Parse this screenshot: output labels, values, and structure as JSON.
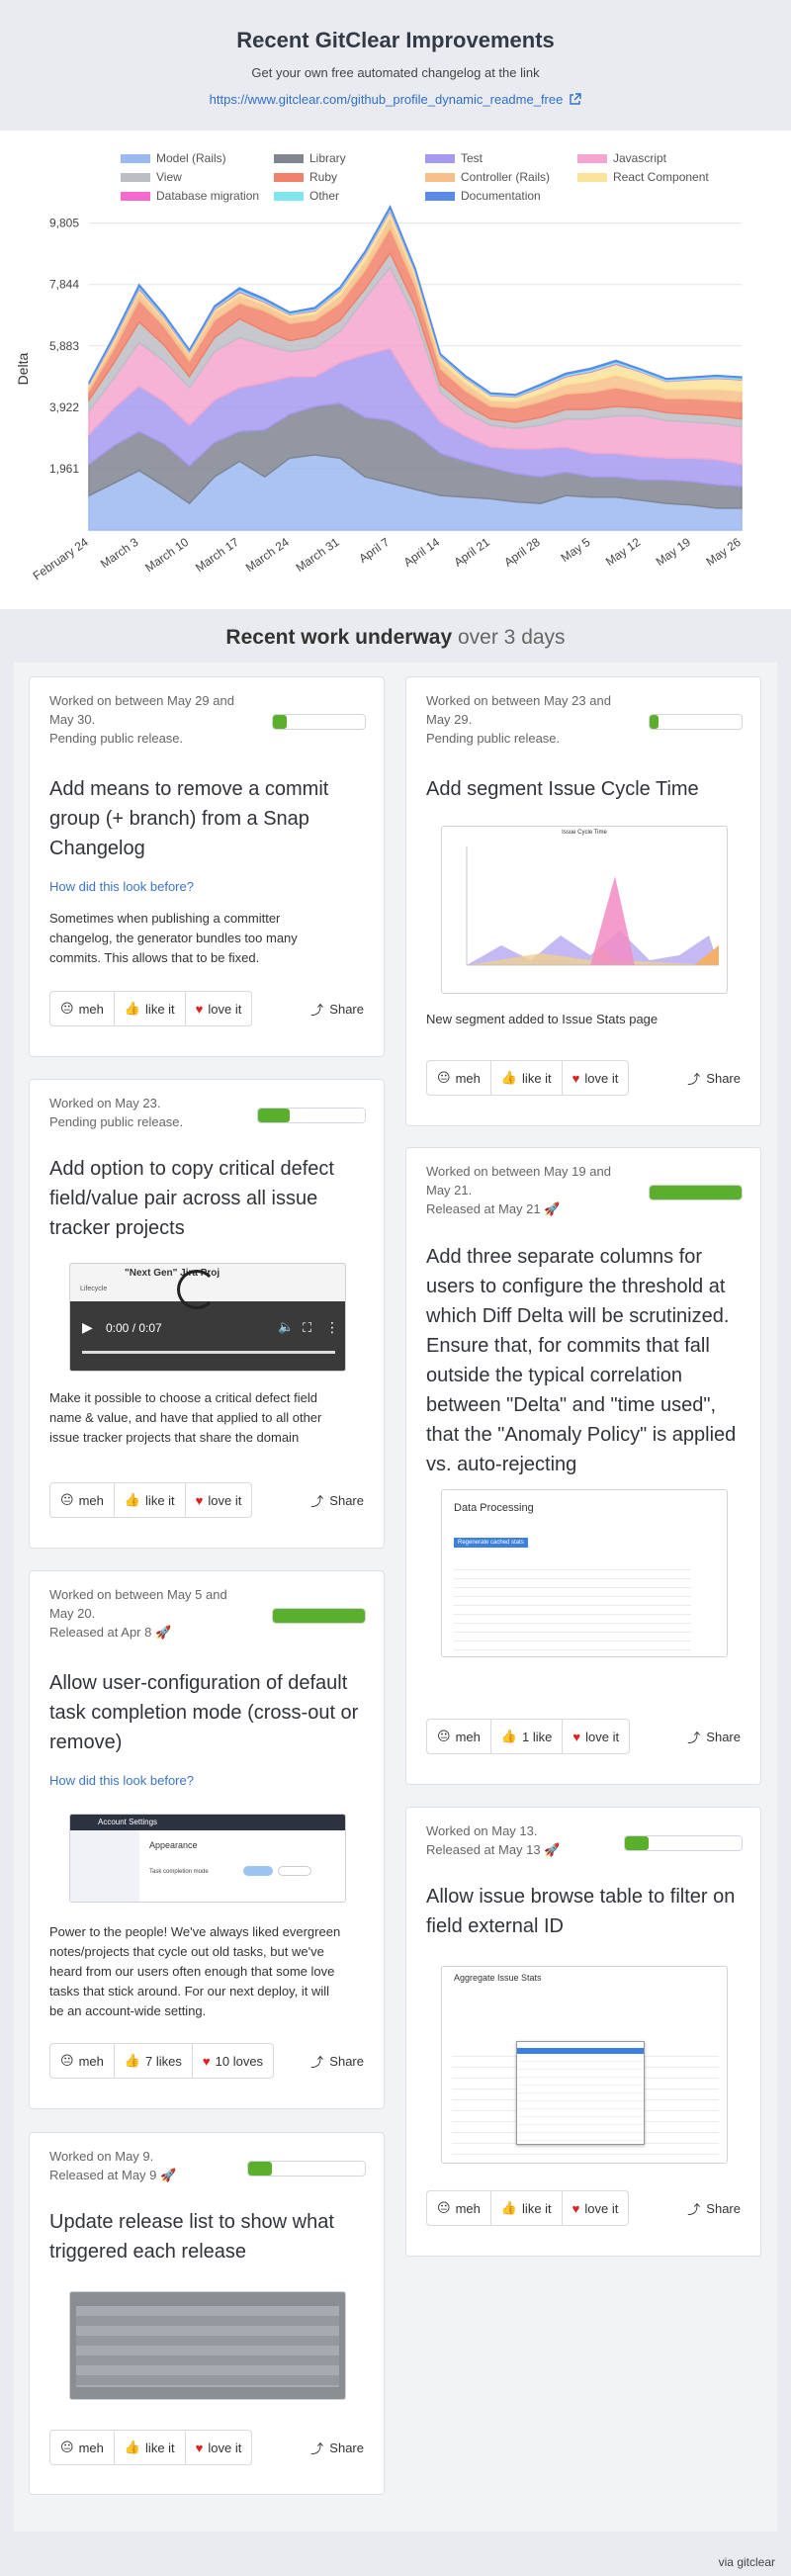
{
  "header": {
    "title": "Recent GitClear Improvements",
    "subtitle": "Get your own free automated changelog at the link",
    "link": "https://www.gitclear.com/github_profile_dynamic_readme_free"
  },
  "chart_data": {
    "type": "area",
    "stacked": true,
    "ylabel": "Delta",
    "yticks": [
      1961,
      3922,
      5883,
      7844,
      9805
    ],
    "ytick_labels": [
      "1,961",
      "3,922",
      "5,883",
      "7,844",
      "9,805"
    ],
    "ylim": [
      0,
      10300
    ],
    "grid": true,
    "legend_position": "top",
    "x": [
      "February 24",
      "March 3",
      "March 10",
      "March 17",
      "March 24",
      "March 31",
      "April 7",
      "April 14",
      "April 21",
      "April 28",
      "May 5",
      "May 12",
      "May 19",
      "May 26"
    ],
    "x_points": [
      0,
      0.5,
      1,
      1.5,
      2,
      2.5,
      3,
      3.5,
      4,
      4.5,
      5,
      5.5,
      6,
      6.5,
      7,
      7.5,
      8,
      8.5,
      9,
      9.5,
      10,
      10.5,
      11,
      11.5,
      12,
      12.5,
      13
    ],
    "series": [
      {
        "name": "Model (Rails)",
        "color": "#9bb8f0",
        "values": [
          1100,
          1500,
          1900,
          1400,
          850,
          1700,
          2200,
          1700,
          2300,
          2400,
          2300,
          1700,
          1500,
          1300,
          1100,
          1050,
          1000,
          900,
          850,
          1100,
          1050,
          1050,
          950,
          850,
          800,
          700,
          700
        ]
      },
      {
        "name": "Library",
        "color": "#808590",
        "values": [
          1000,
          1200,
          1250,
          1350,
          1200,
          1100,
          950,
          1500,
          1400,
          1550,
          1750,
          1900,
          2000,
          1800,
          1350,
          1150,
          1000,
          900,
          850,
          750,
          650,
          650,
          650,
          750,
          750,
          750,
          700
        ]
      },
      {
        "name": "Test",
        "color": "#a69af0",
        "values": [
          950,
          1200,
          1450,
          1350,
          1300,
          1350,
          1400,
          1500,
          1200,
          950,
          1300,
          2000,
          2300,
          1400,
          1000,
          800,
          650,
          800,
          900,
          800,
          750,
          750,
          750,
          700,
          750,
          800,
          700
        ]
      },
      {
        "name": "Javascript",
        "color": "#f4a6cf",
        "values": [
          750,
          950,
          1400,
          1300,
          1200,
          1550,
          1600,
          1200,
          800,
          900,
          1000,
          1800,
          2600,
          2300,
          950,
          750,
          700,
          650,
          750,
          900,
          1100,
          1200,
          1300,
          1200,
          1150,
          1150,
          1200
        ]
      },
      {
        "name": "View",
        "color": "#bcbec6",
        "values": [
          350,
          500,
          650,
          500,
          350,
          450,
          600,
          450,
          350,
          400,
          350,
          300,
          450,
          350,
          250,
          250,
          200,
          200,
          250,
          300,
          300,
          300,
          250,
          250,
          250,
          250,
          250
        ]
      },
      {
        "name": "Ruby",
        "color": "#f0816a",
        "values": [
          300,
          450,
          700,
          600,
          500,
          550,
          500,
          650,
          550,
          500,
          550,
          600,
          800,
          650,
          500,
          450,
          400,
          450,
          500,
          500,
          550,
          600,
          500,
          450,
          500,
          500,
          550
        ]
      },
      {
        "name": "Controller (Rails)",
        "color": "#f7c08a",
        "values": [
          150,
          200,
          250,
          200,
          200,
          250,
          250,
          200,
          200,
          200,
          250,
          300,
          350,
          300,
          250,
          250,
          200,
          200,
          250,
          300,
          350,
          400,
          350,
          300,
          300,
          350,
          350
        ]
      },
      {
        "name": "React Component",
        "color": "#fbe39a",
        "values": [
          50,
          100,
          100,
          80,
          80,
          100,
          100,
          80,
          80,
          100,
          150,
          200,
          200,
          150,
          150,
          150,
          150,
          150,
          200,
          250,
          300,
          350,
          300,
          250,
          300,
          350,
          350
        ]
      },
      {
        "name": "Database migration",
        "color": "#f46bcd",
        "values": [
          20,
          40,
          40,
          30,
          20,
          30,
          40,
          30,
          20,
          30,
          30,
          30,
          40,
          30,
          20,
          20,
          20,
          20,
          30,
          30,
          30,
          30,
          20,
          20,
          20,
          20,
          20
        ]
      },
      {
        "name": "Other",
        "color": "#7fe6ee",
        "values": [
          30,
          50,
          60,
          50,
          40,
          50,
          60,
          50,
          40,
          50,
          50,
          50,
          60,
          50,
          40,
          40,
          40,
          40,
          50,
          50,
          60,
          60,
          50,
          50,
          50,
          50,
          50
        ]
      },
      {
        "name": "Documentation",
        "color": "#5a8ae8",
        "values": [
          20,
          30,
          40,
          30,
          20,
          30,
          40,
          30,
          20,
          30,
          30,
          30,
          40,
          30,
          20,
          20,
          20,
          20,
          30,
          30,
          30,
          30,
          20,
          20,
          20,
          20,
          20
        ]
      }
    ]
  },
  "section": {
    "title_bold": "Recent work underway",
    "title_light": "over 3 days"
  },
  "reactions": {
    "meh": "meh",
    "like": "like it",
    "love": "love it",
    "share": "Share"
  },
  "how_link": "How did this look before?",
  "cards": [
    {
      "meta1": "Worked on between May 29 and",
      "meta2": "May 30.",
      "meta3": "Pending public release.",
      "progress": 0.15,
      "title": [
        "Add means to remove a commit",
        "group (+ branch) from a Snap",
        "Changelog"
      ],
      "desc": [
        "Sometimes when publishing a committer",
        "changelog, the generator bundles too many",
        "commits. This allows that to be fixed."
      ]
    },
    {
      "meta1": "Worked on May 23.",
      "meta2": "Pending public release.",
      "progress": 0.3,
      "title": [
        "Add option to copy critical defect",
        "field/value pair across all issue",
        "tracker projects"
      ],
      "video": {
        "time": "0:00 / 0:07",
        "text1": "\"Next Gen\" Jira Proj",
        "text2": "Lifecycle"
      },
      "desc": [
        "Make it possible to choose a critical defect field",
        "name & value, and have that applied to all other",
        "issue tracker projects that share the domain"
      ]
    },
    {
      "meta1": "Worked on between May 5 and",
      "meta2": "May 20.",
      "meta3": "Released at Apr 8",
      "progress": 1,
      "title": [
        "Allow user-configuration of default",
        "task completion mode (cross-out or",
        "remove)"
      ],
      "shot": {
        "header": "Account Settings",
        "section": "Appearance",
        "field": "Task completion mode"
      },
      "desc": [
        "Power to the people! We've always liked evergreen",
        "notes/projects that cycle out old tasks, but we've",
        "heard from our users often enough that some love",
        "tasks that stick around. For our next deploy, it will",
        "be an account-wide setting."
      ],
      "likes": "7 likes",
      "loves": "10 loves"
    },
    {
      "meta1": "Worked on May 9.",
      "meta2": "Released at May 9",
      "progress": 0.2,
      "title": [
        "Update release list to show what",
        "triggered each release"
      ]
    },
    {
      "meta1": "Worked on between May 23 and",
      "meta2": "May 29.",
      "meta3": "Pending public release.",
      "progress": 0.1,
      "title": [
        "Add segment Issue Cycle Time"
      ],
      "shot": {
        "header": "Issue Cycle Time"
      },
      "desc": [
        "New segment added to Issue Stats page"
      ]
    },
    {
      "meta1": "Worked on between May 19 and",
      "meta2": "May 21.",
      "meta3": "Released at May 21",
      "progress": 1,
      "title": [
        "Add three separate columns for",
        "users to configure the threshold at",
        "which Diff Delta will be scrutinized.",
        "Ensure that, for commits that fall",
        "outside the typical correlation",
        "between \"Delta\" and \"time used\",",
        "that the \"Anomaly Policy\" is applied",
        "vs. auto-rejecting"
      ],
      "shot": {
        "header": "Data Processing",
        "button": "Regenerate cached stats"
      },
      "likes": "1 like"
    },
    {
      "meta1": "Worked on May 13.",
      "meta2": "Released at May 13",
      "progress": 0.2,
      "title": [
        "Allow issue browse table to filter on",
        "field external ID"
      ],
      "shot": {
        "header": "Aggregate Issue Stats"
      }
    }
  ],
  "footer": "via gitclear"
}
